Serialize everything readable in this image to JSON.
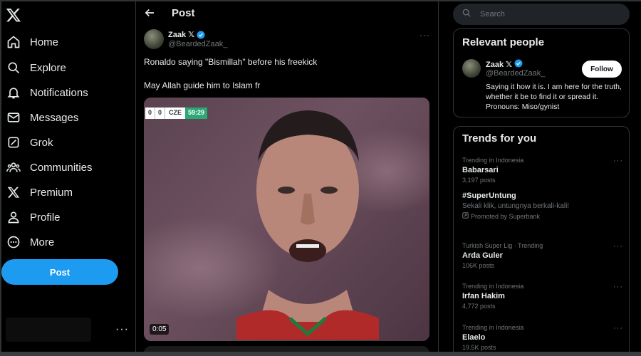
{
  "nav": {
    "items": [
      {
        "label": "Home",
        "icon": "home-icon"
      },
      {
        "label": "Explore",
        "icon": "search-icon"
      },
      {
        "label": "Notifications",
        "icon": "bell-icon"
      },
      {
        "label": "Messages",
        "icon": "mail-icon"
      },
      {
        "label": "Grok",
        "icon": "grok-icon"
      },
      {
        "label": "Communities",
        "icon": "communities-icon"
      },
      {
        "label": "Premium",
        "icon": "x-icon"
      },
      {
        "label": "Profile",
        "icon": "profile-icon"
      },
      {
        "label": "More",
        "icon": "more-circle-icon"
      }
    ],
    "post_button": "Post",
    "account_more": "···"
  },
  "main": {
    "title": "Post",
    "tweet": {
      "author_name": "Zaak 𝕏",
      "author_handle": "@BeardedZaak_",
      "text_line1": "Ronaldo saying \"Bismillah\" before his freekick",
      "text_line2": "May Allah guide him to Islam fr",
      "more": "···",
      "video": {
        "score_home": "0",
        "score_away": "0",
        "team": "CZE",
        "match_time": "59:29",
        "duration": "0:05"
      }
    }
  },
  "right": {
    "search_placeholder": "Search",
    "relevant_people": {
      "title": "Relevant people",
      "name": "Zaak 𝕏",
      "handle": "@BeardedZaak_",
      "follow_label": "Follow",
      "bio": "Saying it how it is. I am here for the truth, whether it be to find it or spread it. Pronouns: Miso/gynist"
    },
    "trends": {
      "title": "Trends for you",
      "items": [
        {
          "meta": "Trending in Indonesia",
          "name": "Babarsari",
          "count": "3,197 posts"
        },
        {
          "meta": "",
          "name": "#SuperUntung",
          "desc": "Sekali klik, untungnya berkali-kali!",
          "promo": "Promoted by Superbank"
        },
        {
          "meta": "Turkish Super Lig · Trending",
          "name": "Arda Guler",
          "count": "106K posts"
        },
        {
          "meta": "Trending in Indonesia",
          "name": "Irfan Hakim",
          "count": "4,772 posts"
        },
        {
          "meta": "Trending in Indonesia",
          "name": "Elaelo",
          "count": "19.5K posts"
        }
      ]
    }
  },
  "colors": {
    "accent": "#1d9bf0",
    "background": "#000000",
    "border": "#2f3336",
    "muted": "#71767b"
  }
}
